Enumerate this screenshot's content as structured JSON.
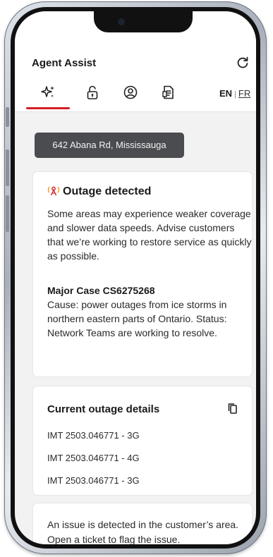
{
  "header": {
    "title": "Agent Assist",
    "refresh_icon": "refresh-icon"
  },
  "tabs": [
    {
      "icon": "sparkle-icon",
      "selected": true
    },
    {
      "icon": "lock-icon",
      "selected": false
    },
    {
      "icon": "user-circle-icon",
      "selected": false
    },
    {
      "icon": "document-icon",
      "selected": false
    }
  ],
  "language": {
    "en": "EN",
    "separator": "|",
    "fr": "FR"
  },
  "address": "642 Abana Rd, Mississauga",
  "outage_card": {
    "title": "Outage detected",
    "icon": "signal-alert-icon",
    "description": "Some areas may experience weaker coverage and slower data speeds. Advise customers that we’re working to restore service as quickly as possible.",
    "case_title": "Major Case CS6275268",
    "case_details": "Cause: power outages from ice storms in northern eastern parts of Ontario. Status: Network Teams are working to resolve."
  },
  "details_card": {
    "title": "Current outage details",
    "rows": [
      "IMT 2503.046771 - 3G",
      "IMT 2503.046771 - 4G",
      "IMT 2503.046771 - 3G"
    ]
  },
  "issue_card": {
    "text": "An issue is detected in the customer’s area. Open a ticket to flag the issue."
  },
  "colors": {
    "accent": "#d21f26",
    "address_bg": "#4a4c50",
    "alert_icon": "#f2a02a",
    "screen_bg": "#f2f2f2"
  }
}
